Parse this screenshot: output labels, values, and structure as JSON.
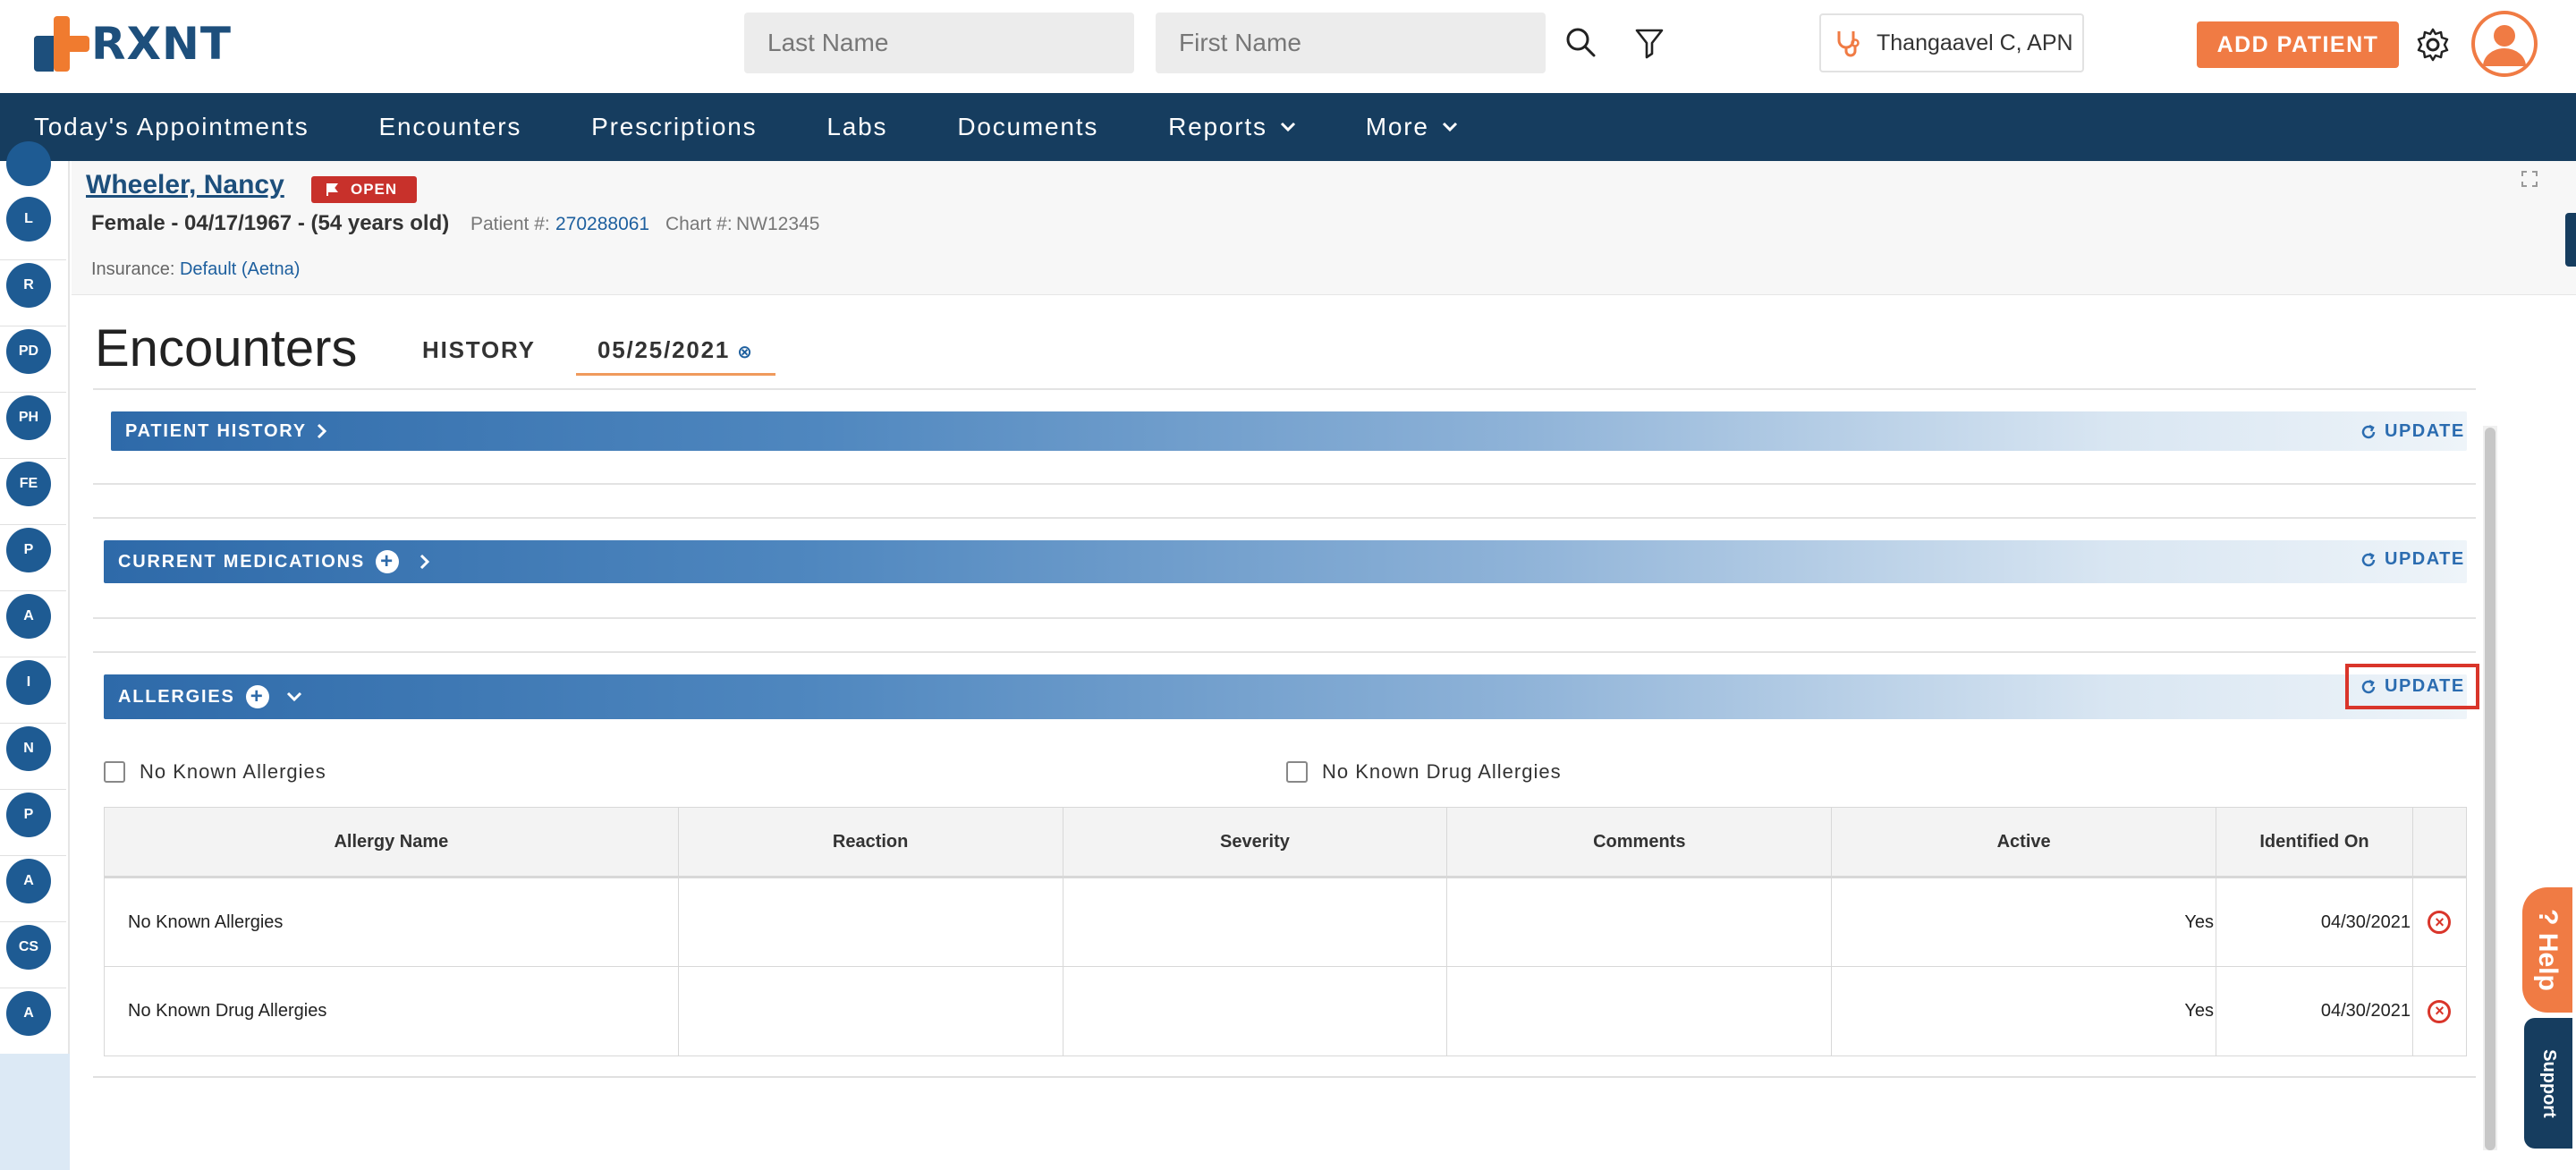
{
  "header": {
    "logo_text": "RXNT",
    "last_name_placeholder": "Last Name",
    "first_name_placeholder": "First Name",
    "provider": "Thangaavel C, APN",
    "add_patient": "ADD PATIENT",
    "brand_orange": "#f07b44",
    "brand_navy": "#163d5f"
  },
  "nav": {
    "items": [
      {
        "label": "Today's Appointments"
      },
      {
        "label": "Encounters"
      },
      {
        "label": "Prescriptions"
      },
      {
        "label": "Labs"
      },
      {
        "label": "Documents"
      },
      {
        "label": "Reports",
        "dropdown": true
      },
      {
        "label": "More",
        "dropdown": true
      }
    ]
  },
  "rail": {
    "items": [
      "L",
      "R",
      "PD",
      "PH",
      "FE",
      "P",
      "A",
      "I",
      "N",
      "P",
      "A",
      "CS",
      "A"
    ]
  },
  "patient": {
    "name": "Wheeler, Nancy",
    "status": "OPEN",
    "demographics": "Female - 04/17/1967 - (54 years old)",
    "patient_label": "Patient #:",
    "patient_number": "270288061",
    "chart_label": "Chart #:",
    "chart_number": "NW12345",
    "insurance_label": "Insurance:",
    "insurance_value": "Default (Aetna)"
  },
  "encounters": {
    "title": "Encounters",
    "tab_history": "HISTORY",
    "tab_date": "05/25/2021",
    "tab_close": "⊗"
  },
  "sections": {
    "patient_history": {
      "label": "PATIENT HISTORY",
      "update": "UPDATE"
    },
    "current_medications": {
      "label": "CURRENT MEDICATIONS",
      "update": "UPDATE"
    },
    "allergies": {
      "label": "ALLERGIES",
      "update": "UPDATE"
    }
  },
  "allergies": {
    "checkbox_nka": "No Known Allergies",
    "checkbox_nkda": "No Known Drug Allergies",
    "columns": [
      "Allergy Name",
      "Reaction",
      "Severity",
      "Comments",
      "Active",
      "Identified On"
    ],
    "rows": [
      {
        "name": "No Known Allergies",
        "reaction": "",
        "severity": "",
        "comments": "",
        "active": "Yes",
        "identified_on": "04/30/2021"
      },
      {
        "name": "No Known Drug Allergies",
        "reaction": "",
        "severity": "",
        "comments": "",
        "active": "Yes",
        "identified_on": "04/30/2021"
      }
    ]
  },
  "side_tabs": {
    "help": "? Help",
    "support": "Support"
  }
}
